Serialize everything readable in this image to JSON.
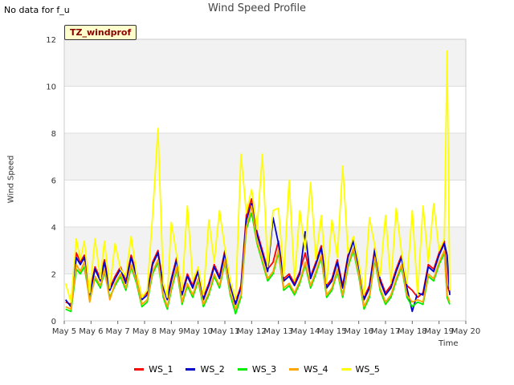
{
  "header": {
    "no_data_text": "No data for f_u",
    "title": "Wind Speed Profile",
    "badge": "TZ_windprof"
  },
  "chart_data": {
    "type": "line",
    "title": "Wind Speed Profile",
    "xlabel": "Time",
    "ylabel": "Wind Speed",
    "ylim": [
      0,
      12
    ],
    "yticks": [
      0,
      2,
      4,
      6,
      8,
      10,
      12
    ],
    "xlim": [
      0,
      15
    ],
    "xtick_labels": [
      "May 5",
      "May 6",
      "May 7",
      "May 8",
      "May 9",
      "May 10",
      "May 11",
      "May 12",
      "May 13",
      "May 14",
      "May 15",
      "May 16",
      "May 17",
      "May 18",
      "May 19",
      "May 20"
    ],
    "grid": true,
    "legend_position": "bottom",
    "x": [
      0.05,
      0.25,
      0.45,
      0.6,
      0.75,
      0.95,
      1.15,
      1.35,
      1.5,
      1.7,
      1.9,
      2.1,
      2.3,
      2.5,
      2.7,
      2.9,
      3.1,
      3.3,
      3.5,
      3.7,
      3.85,
      4.0,
      4.2,
      4.4,
      4.6,
      4.8,
      5.0,
      5.2,
      5.4,
      5.6,
      5.8,
      6.0,
      6.2,
      6.4,
      6.6,
      6.8,
      7.0,
      7.2,
      7.4,
      7.6,
      7.8,
      8.0,
      8.2,
      8.4,
      8.6,
      8.8,
      9.0,
      9.2,
      9.4,
      9.6,
      9.8,
      10.0,
      10.2,
      10.4,
      10.6,
      10.8,
      11.0,
      11.2,
      11.4,
      11.6,
      11.8,
      12.0,
      12.2,
      12.4,
      12.6,
      12.8,
      13.0,
      13.2,
      13.4,
      13.6,
      13.8,
      14.0,
      14.2,
      14.3,
      14.4
    ],
    "series": [
      {
        "name": "WS_1",
        "color": "#ff0000",
        "values": [
          0.8,
          0.7,
          2.9,
          2.5,
          2.8,
          1.2,
          2.3,
          1.8,
          2.6,
          1.4,
          1.9,
          2.3,
          1.7,
          2.8,
          2.0,
          1.0,
          1.2,
          2.5,
          3.0,
          1.5,
          1.0,
          1.8,
          2.7,
          1.2,
          2.0,
          1.5,
          2.2,
          1.0,
          1.6,
          2.4,
          1.9,
          3.0,
          1.6,
          0.8,
          1.5,
          4.5,
          5.2,
          3.8,
          3.0,
          2.2,
          2.5,
          3.4,
          1.8,
          2.0,
          1.6,
          2.1,
          2.9,
          1.9,
          2.5,
          3.2,
          1.5,
          1.8,
          2.6,
          1.5,
          2.8,
          3.5,
          2.4,
          1.0,
          1.5,
          3.1,
          1.8,
          1.2,
          1.5,
          2.2,
          2.8,
          1.5,
          1.3,
          1.0,
          1.2,
          2.4,
          2.2,
          2.9,
          3.4,
          1.5,
          1.2
        ]
      },
      {
        "name": "WS_2",
        "color": "#0000cc",
        "values": [
          0.9,
          0.6,
          2.7,
          2.4,
          2.7,
          1.1,
          2.2,
          1.7,
          2.5,
          1.3,
          1.8,
          2.2,
          1.6,
          2.7,
          1.9,
          0.9,
          1.1,
          2.4,
          2.9,
          1.4,
          0.9,
          1.7,
          2.6,
          1.1,
          1.9,
          1.4,
          2.1,
          0.9,
          1.5,
          2.3,
          1.8,
          2.9,
          1.5,
          0.7,
          1.4,
          4.3,
          5.0,
          3.7,
          2.9,
          2.1,
          4.4,
          3.3,
          1.7,
          1.9,
          1.5,
          2.0,
          3.8,
          1.8,
          2.4,
          3.1,
          1.4,
          1.7,
          2.5,
          1.4,
          2.7,
          3.4,
          2.3,
          0.9,
          1.4,
          3.0,
          1.7,
          1.1,
          1.4,
          2.1,
          2.7,
          1.4,
          0.4,
          1.2,
          1.1,
          2.3,
          2.1,
          2.8,
          3.3,
          2.8,
          1.1
        ]
      },
      {
        "name": "WS_3",
        "color": "#00ee00",
        "values": [
          0.5,
          0.4,
          2.2,
          2.0,
          2.3,
          0.9,
          1.8,
          1.4,
          2.1,
          1.0,
          1.5,
          1.9,
          1.3,
          2.3,
          1.6,
          0.6,
          0.8,
          2.0,
          2.5,
          1.0,
          0.5,
          1.3,
          2.2,
          0.7,
          1.5,
          1.0,
          1.7,
          0.6,
          1.1,
          1.9,
          1.4,
          2.5,
          1.1,
          0.3,
          1.0,
          3.9,
          4.6,
          3.3,
          2.5,
          1.7,
          2.0,
          2.9,
          1.3,
          1.5,
          1.1,
          1.6,
          2.4,
          1.4,
          2.0,
          2.7,
          1.0,
          1.3,
          2.1,
          1.0,
          2.3,
          3.0,
          1.9,
          0.5,
          1.0,
          2.6,
          1.3,
          0.7,
          1.0,
          1.7,
          2.3,
          1.0,
          0.6,
          0.8,
          0.7,
          1.9,
          1.7,
          2.4,
          2.9,
          1.0,
          0.7
        ]
      },
      {
        "name": "WS_4",
        "color": "#ffa500",
        "values": [
          0.6,
          0.5,
          2.4,
          2.1,
          2.5,
          0.8,
          1.9,
          1.5,
          2.2,
          0.9,
          1.6,
          2.0,
          1.4,
          2.4,
          1.7,
          0.7,
          0.9,
          2.1,
          2.6,
          1.1,
          0.6,
          1.4,
          2.3,
          0.8,
          1.6,
          1.1,
          1.8,
          0.7,
          1.2,
          2.0,
          1.5,
          2.6,
          1.2,
          0.5,
          1.1,
          4.0,
          4.9,
          3.4,
          2.6,
          1.8,
          2.1,
          3.0,
          1.4,
          1.6,
          1.2,
          1.7,
          2.5,
          1.5,
          2.1,
          2.8,
          1.1,
          1.4,
          2.2,
          1.1,
          2.4,
          3.1,
          2.0,
          0.6,
          1.1,
          2.7,
          1.4,
          0.8,
          1.1,
          1.8,
          2.4,
          1.1,
          0.8,
          0.9,
          0.8,
          2.0,
          1.8,
          2.5,
          3.0,
          1.1,
          0.8
        ]
      },
      {
        "name": "WS_5",
        "color": "#ffff00",
        "values": [
          1.6,
          0.8,
          3.5,
          2.6,
          3.4,
          1.2,
          3.5,
          1.8,
          3.4,
          1.4,
          3.3,
          2.2,
          1.9,
          3.6,
          2.0,
          1.0,
          1.3,
          4.5,
          8.2,
          1.6,
          1.0,
          4.2,
          2.8,
          1.3,
          4.9,
          1.7,
          2.3,
          1.1,
          4.3,
          2.5,
          4.7,
          3.1,
          1.7,
          0.9,
          7.1,
          4.6,
          5.6,
          3.9,
          7.1,
          2.3,
          4.7,
          4.8,
          1.9,
          6.0,
          1.7,
          4.7,
          3.0,
          5.9,
          2.6,
          4.5,
          1.6,
          4.3,
          2.7,
          6.6,
          2.9,
          3.6,
          2.5,
          1.1,
          4.4,
          3.2,
          1.9,
          4.5,
          1.6,
          4.8,
          2.9,
          1.6,
          4.7,
          1.1,
          4.9,
          2.5,
          5.0,
          3.0,
          3.5,
          11.5,
          1.3
        ]
      }
    ]
  }
}
